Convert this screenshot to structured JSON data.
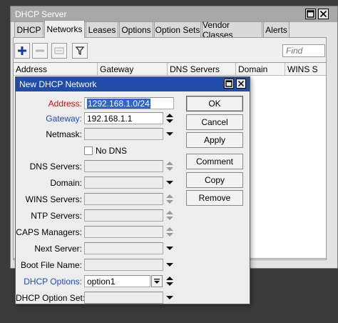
{
  "outer_window": {
    "title": "DHCP Server",
    "tabs": [
      "DHCP",
      "Networks",
      "Leases",
      "Options",
      "Option Sets",
      "Vendor Classes",
      "Alerts"
    ],
    "active_tab": "Networks",
    "find_placeholder": "Find",
    "columns": [
      "Address",
      "Gateway",
      "DNS Servers",
      "Domain",
      "WINS S"
    ]
  },
  "dialog": {
    "title": "New DHCP Network",
    "fields": {
      "address": {
        "label": "Address:",
        "value": "1292.168.1.0/24"
      },
      "gateway": {
        "label": "Gateway:",
        "value": "192.168.1.1"
      },
      "netmask": {
        "label": "Netmask:",
        "value": ""
      },
      "no_dns": {
        "label": "No DNS",
        "checked": false
      },
      "dns_servers": {
        "label": "DNS Servers:",
        "value": ""
      },
      "domain": {
        "label": "Domain:",
        "value": ""
      },
      "wins_servers": {
        "label": "WINS Servers:",
        "value": ""
      },
      "ntp_servers": {
        "label": "NTP Servers:",
        "value": ""
      },
      "caps_managers": {
        "label": "CAPS Managers:",
        "value": ""
      },
      "next_server": {
        "label": "Next Server:",
        "value": ""
      },
      "boot_file_name": {
        "label": "Boot File Name:",
        "value": ""
      },
      "dhcp_options": {
        "label": "DHCP Options:",
        "value": "option1"
      },
      "dhcp_option_set": {
        "label": "DHCP Option Set:",
        "value": ""
      }
    },
    "buttons": {
      "ok": "OK",
      "cancel": "Cancel",
      "apply": "Apply",
      "comment": "Comment",
      "copy": "Copy",
      "remove": "Remove"
    }
  },
  "colors": {
    "dialog_title_bar": "#1f4da8",
    "outer_title_bar": "#a8a8a8",
    "required_label": "#d01010",
    "link_label": "#1f4db8",
    "selection": "#2f64d0"
  }
}
